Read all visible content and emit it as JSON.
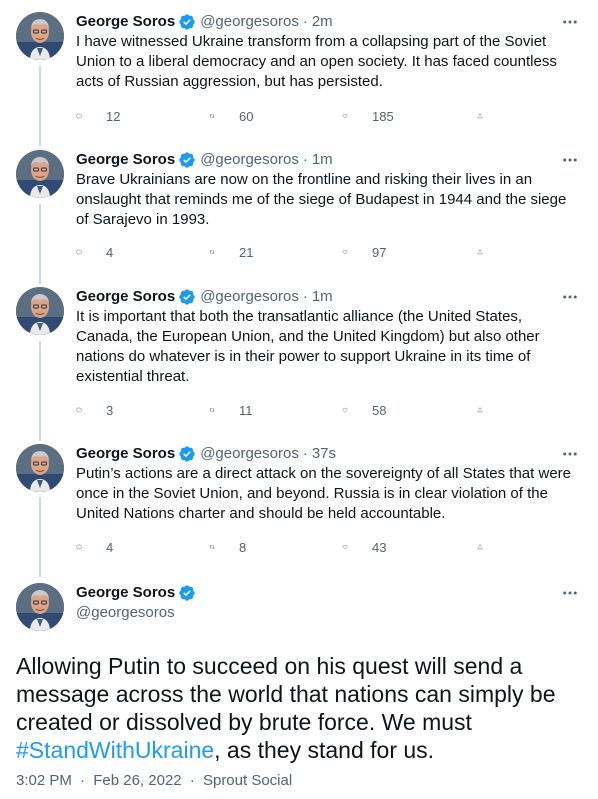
{
  "thread": [
    {
      "name": "George Soros",
      "handle": "@georgesoros",
      "separator": "·",
      "time": "2m",
      "text": "I have witnessed Ukraine transform from a collapsing part of the Soviet Union to a liberal democracy and an open society. It has faced countless acts of Russian aggression, but has persisted.",
      "replies": "12",
      "retweets": "60",
      "likes": "185"
    },
    {
      "name": "George Soros",
      "handle": "@georgesoros",
      "separator": "·",
      "time": "1m",
      "text": "Brave Ukrainians are now on the frontline and risking their lives in an onslaught that reminds me of the siege of Budapest in 1944 and the siege of Sarajevo in 1993.",
      "replies": "4",
      "retweets": "21",
      "likes": "97"
    },
    {
      "name": "George Soros",
      "handle": "@georgesoros",
      "separator": "·",
      "time": "1m",
      "text": "It is important that both the transatlantic alliance (the United States, Canada, the European Union, and the United Kingdom) but also other nations do whatever is in their power to support Ukraine in its time of existential threat.",
      "replies": "3",
      "retweets": "11",
      "likes": "58"
    },
    {
      "name": "George Soros",
      "handle": "@georgesoros",
      "separator": "·",
      "time": "37s",
      "text": "Putin’s actions are a direct attack on the sovereignty of all States that were once in the Soviet Union, and beyond. Russia is in clear violation of the United Nations charter and should be held accountable.",
      "replies": "4",
      "retweets": "8",
      "likes": "43"
    }
  ],
  "main": {
    "name": "George Soros",
    "handle": "@georgesoros",
    "text_before": "Allowing Putin to succeed on his quest will send a message across the world that nations can simply be created or dissolved by brute force. We must ",
    "hashtag": "#StandWithUkraine",
    "text_after": ", as they stand for us.",
    "time": "3:02 PM",
    "date": "Feb 26, 2022",
    "separator": "·",
    "source": "Sprout Social"
  },
  "icons": {
    "verified": "verified-badge-icon",
    "more": "more-horizontal-icon",
    "reply": "reply-icon",
    "retweet": "retweet-icon",
    "like": "heart-icon",
    "share": "share-icon"
  },
  "colors": {
    "accent": "#1d9bf0",
    "text": "#0f1419",
    "secondary": "#536471",
    "thread_line": "#cfd9de"
  }
}
